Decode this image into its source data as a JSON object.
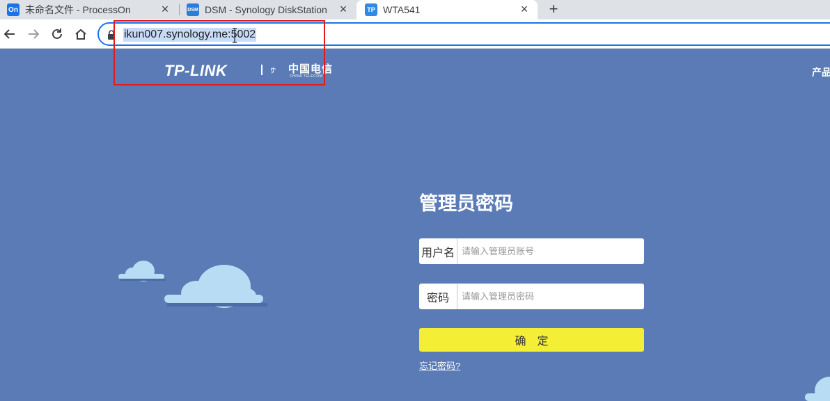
{
  "browser": {
    "tabs": [
      {
        "favicon": "On",
        "favicon_color": "#1a73e8",
        "title": "未命名文件 - ProcessOn",
        "close": "×"
      },
      {
        "favicon": "DSM",
        "favicon_color": "#2f7bd8",
        "title": "DSM - Synology DiskStation",
        "close": "×"
      },
      {
        "favicon": "TP",
        "favicon_color": "#2f8ae5",
        "title": "WTA541",
        "close": "×",
        "active": true
      }
    ],
    "new_tab": "+",
    "url": "ikun007.synology.me:5002"
  },
  "header": {
    "logo_tplink": "TP-LINK",
    "logo_partner_cn": "中国电信",
    "logo_partner_en": "CHINA TELECOM",
    "nav_products": "产品"
  },
  "login": {
    "title": "管理员密码",
    "username_label": "用户名",
    "username_placeholder": "请输入管理员账号",
    "password_label": "密码",
    "password_placeholder": "请输入管理员密码",
    "submit_label": "确定",
    "forgot_link": "忘记密码?"
  },
  "colors": {
    "page_bg": "#5a7bb5",
    "submit_bg": "#f4ee36",
    "cloud": "#b7dcf4",
    "annotation_box": "#e01b1b",
    "omnibox_focus": "#1a73e8"
  }
}
